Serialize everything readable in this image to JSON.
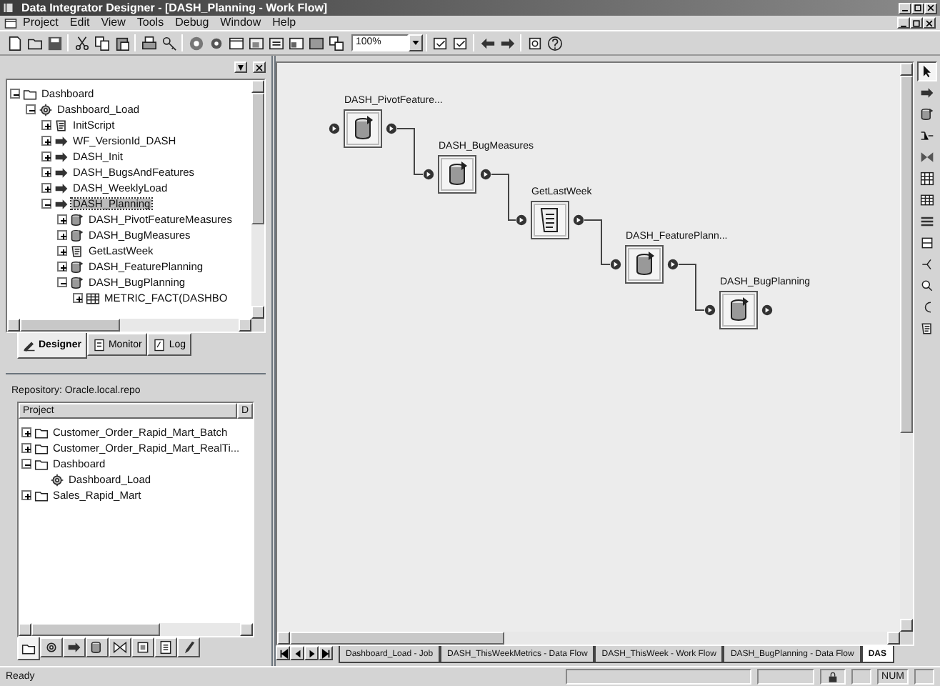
{
  "window": {
    "title": "Data Integrator Designer - [DASH_Planning - Work Flow]"
  },
  "menu": [
    "Project",
    "Edit",
    "View",
    "Tools",
    "Debug",
    "Window",
    "Help"
  ],
  "toolbar": {
    "zoom": "100%"
  },
  "object_tree": [
    {
      "label": "Dashboard",
      "kind": "folder",
      "expanded": true,
      "selected": false,
      "children": [
        {
          "label": "Dashboard_Load",
          "kind": "job",
          "expanded": true,
          "selected": false,
          "children": [
            {
              "label": "InitScript",
              "kind": "script",
              "expanded": false,
              "selected": false
            },
            {
              "label": "WF_VersionId_DASH",
              "kind": "workflow",
              "expanded": false,
              "selected": false
            },
            {
              "label": "DASH_Init",
              "kind": "workflow",
              "expanded": false,
              "selected": false
            },
            {
              "label": "DASH_BugsAndFeatures",
              "kind": "workflow",
              "expanded": false,
              "selected": false
            },
            {
              "label": "DASH_WeeklyLoad",
              "kind": "workflow",
              "expanded": false,
              "selected": false
            },
            {
              "label": "DASH_Planning",
              "kind": "workflow",
              "expanded": true,
              "selected": true,
              "children": [
                {
                  "label": "DASH_PivotFeatureMeasures",
                  "kind": "dataflow",
                  "expanded": false,
                  "selected": false
                },
                {
                  "label": "DASH_BugMeasures",
                  "kind": "dataflow",
                  "expanded": false,
                  "selected": false
                },
                {
                  "label": "GetLastWeek",
                  "kind": "script",
                  "expanded": false,
                  "selected": false
                },
                {
                  "label": "DASH_FeaturePlanning",
                  "kind": "dataflow",
                  "expanded": false,
                  "selected": false
                },
                {
                  "label": "DASH_BugPlanning",
                  "kind": "dataflow",
                  "expanded": true,
                  "selected": false,
                  "children": [
                    {
                      "label": "METRIC_FACT(DASHBO",
                      "kind": "table",
                      "expanded": false,
                      "selected": false
                    }
                  ]
                }
              ]
            }
          ]
        }
      ]
    }
  ],
  "left_tabs": [
    {
      "label": "Designer",
      "kind": "designer",
      "selected": true
    },
    {
      "label": "Monitor",
      "kind": "monitor",
      "selected": false
    },
    {
      "label": "Log",
      "kind": "log",
      "selected": false
    }
  ],
  "repository": {
    "label": "Repository: Oracle.local.repo",
    "columns": [
      "Project",
      "D"
    ],
    "items": [
      {
        "label": "Customer_Order_Rapid_Mart_Batch",
        "kind": "folder",
        "expanded": false
      },
      {
        "label": "Customer_Order_Rapid_Mart_RealTi...",
        "kind": "folder",
        "expanded": false
      },
      {
        "label": "Dashboard",
        "kind": "folder",
        "expanded": true,
        "children": [
          {
            "label": "Dashboard_Load",
            "kind": "job"
          }
        ]
      },
      {
        "label": "Sales_Rapid_Mart",
        "kind": "folder",
        "expanded": false
      }
    ],
    "tabs": [
      {
        "kind": "projects",
        "selected": true
      },
      {
        "kind": "jobs",
        "selected": false
      },
      {
        "kind": "workflows",
        "selected": false
      },
      {
        "kind": "dataflows",
        "selected": false
      },
      {
        "kind": "transforms",
        "selected": false
      },
      {
        "kind": "datastores",
        "selected": false
      },
      {
        "kind": "formats",
        "selected": false
      },
      {
        "kind": "functions",
        "selected": false
      }
    ]
  },
  "workflow": {
    "nodes": [
      {
        "label": "DASH_PivotFeature...",
        "kind": "dataflow"
      },
      {
        "label": "DASH_BugMeasures",
        "kind": "dataflow"
      },
      {
        "label": "GetLastWeek",
        "kind": "script"
      },
      {
        "label": "DASH_FeaturePlann...",
        "kind": "dataflow"
      },
      {
        "label": "DASH_BugPlanning",
        "kind": "dataflow"
      }
    ]
  },
  "palette": [
    {
      "kind": "pointer",
      "selected": true
    },
    {
      "kind": "workflow",
      "selected": false
    },
    {
      "kind": "dataflow",
      "selected": false
    },
    {
      "kind": "query",
      "selected": false
    },
    {
      "kind": "transform",
      "selected": false
    },
    {
      "kind": "template",
      "selected": false
    },
    {
      "kind": "table",
      "selected": false
    },
    {
      "kind": "file",
      "selected": false
    },
    {
      "kind": "conditional",
      "selected": false
    },
    {
      "kind": "try",
      "selected": false
    },
    {
      "kind": "catch",
      "selected": false
    },
    {
      "kind": "annotation",
      "selected": false
    },
    {
      "kind": "script",
      "selected": false
    }
  ],
  "document_tabs": [
    {
      "label": "Dashboard_Load - Job",
      "selected": false
    },
    {
      "label": "DASH_ThisWeekMetrics - Data Flow",
      "selected": false
    },
    {
      "label": "DASH_ThisWeek - Work Flow",
      "selected": false
    },
    {
      "label": "DASH_BugPlanning - Data Flow",
      "selected": false
    },
    {
      "label": "DAS",
      "selected": true
    }
  ],
  "status_bar": {
    "text": "Ready",
    "mode": "NUM"
  }
}
